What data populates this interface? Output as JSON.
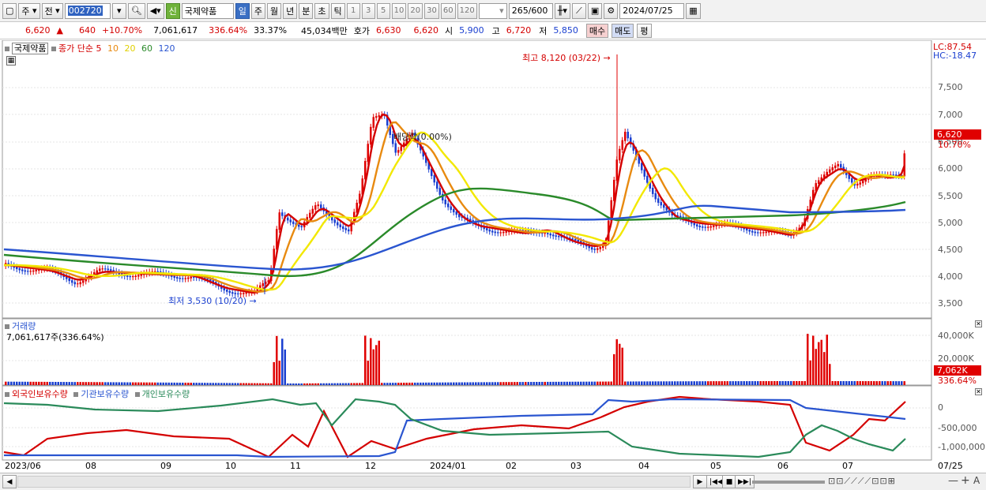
{
  "toolbar": {
    "period_main": "주",
    "prev_label": "전",
    "code": "002720",
    "new_badge": "신",
    "stock_name": "국제약품",
    "periods": [
      "일",
      "주",
      "월",
      "년",
      "분",
      "초",
      "틱"
    ],
    "intervals": [
      "1",
      "3",
      "5",
      "10",
      "20",
      "30",
      "60",
      "120"
    ],
    "count": "265",
    "count_max": "/600",
    "date": "2024/07/25"
  },
  "quote": {
    "price": "6,620",
    "change": "640",
    "rate": "+10.70%",
    "volume": "7,061,617",
    "vol_ratio": "336.64%",
    "turnover": "33.37%",
    "amount": "45,034백만",
    "ask_label": "호가",
    "ask1": "6,630",
    "ask2": "6,620",
    "open_label": "시",
    "open": "5,900",
    "high_label": "고",
    "high": "6,720",
    "low_label": "저",
    "low": "5,850",
    "buy": "매수",
    "sell": "매도",
    "eval": "평"
  },
  "price_panel": {
    "stock_name": "국제약품",
    "ma_label": "종가 단순",
    "ma_periods": [
      "5",
      "10",
      "20",
      "60",
      "120"
    ],
    "ma_colors": [
      "#d40000",
      "#e88a10",
      "#f2e800",
      "#2a8a2a",
      "#2a55d0"
    ],
    "lc": "LC:87.54",
    "hc": "HC:-18.47",
    "y_ticks": [
      "7,500",
      "7,000",
      "6,500",
      "6,000",
      "5,500",
      "5,000",
      "4,500",
      "4,000",
      "3,500"
    ],
    "current_price": "6,620",
    "current_rate": "10.70%",
    "high_note": "최고 8,120 (03/22)",
    "low_note": "최저 3,530 (10/20)",
    "event_note": "배당락(0.00%)"
  },
  "volume_panel": {
    "title": "거래량",
    "value": "7,061,617주(336.64%)",
    "y_ticks": [
      "40,000K",
      "20,000K"
    ],
    "current": "7,062K",
    "ratio": "336.64%"
  },
  "holder_panel": {
    "series": [
      "외국인보유수량",
      "기관보유수량",
      "개인보유수량"
    ],
    "colors": [
      "#d40000",
      "#2a55d0",
      "#2a8a5a"
    ],
    "y_ticks": [
      "0",
      "-500,000",
      "-1,000,000"
    ]
  },
  "x_axis": {
    "labels": [
      "2023/06",
      "08",
      "09",
      "10",
      "11",
      "12",
      "2024/01",
      "02",
      "03",
      "04",
      "05",
      "06",
      "07"
    ],
    "end_label": "07/25"
  },
  "colors": {
    "up": "#d40000",
    "down": "#1a3fd0",
    "selected": "#3a6fc4"
  }
}
